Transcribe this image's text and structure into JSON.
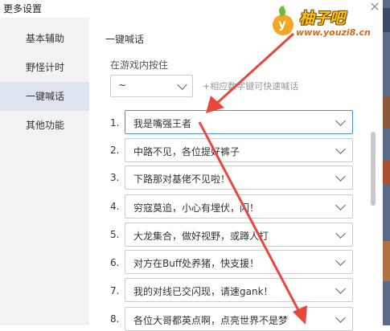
{
  "window": {
    "title": "更多设置",
    "close_icon": "close-icon"
  },
  "sidebar": {
    "items": [
      {
        "label": "基本辅助",
        "active": false
      },
      {
        "label": "野怪计时",
        "active": false
      },
      {
        "label": "一键喊话",
        "active": true
      },
      {
        "label": "其他功能",
        "active": false
      }
    ]
  },
  "main": {
    "section_title": "一键喊话",
    "trigger_label": "在游戏内按住",
    "key_select_value": "~",
    "hint": "+相应数字键可快速喊话",
    "messages": [
      {
        "num": "1.",
        "text": "我是嘴强王者",
        "focused": true
      },
      {
        "num": "2.",
        "text": "中路不见，各位提好裤子"
      },
      {
        "num": "3.",
        "text": "下路那对基佬不见啦！"
      },
      {
        "num": "4.",
        "text": "穷寇莫追，小心有埋伏，闪！"
      },
      {
        "num": "5.",
        "text": "大龙集合，做好视野，或蹲人打"
      },
      {
        "num": "6.",
        "text": "对方在Buff处养猪，快支援！"
      },
      {
        "num": "7.",
        "text": "我的对线已交闪现，请速gank！"
      },
      {
        "num": "8.",
        "text": "各位大哥都英点啊，点亮世界不是梦"
      }
    ]
  },
  "watermark": {
    "name": "柚子吧",
    "url": "www.youzi8.cn",
    "letter": "y"
  },
  "colors": {
    "active_bg": "#dde4ef",
    "focus_border": "#4a90e2",
    "arrow": "#e8473b"
  }
}
